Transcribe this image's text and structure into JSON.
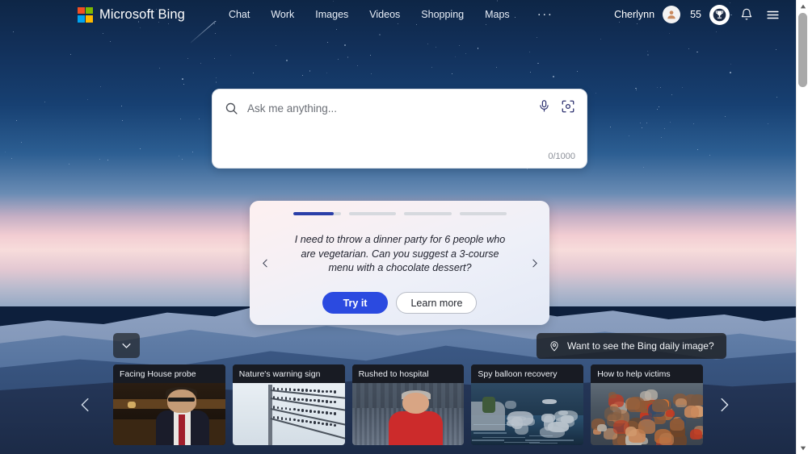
{
  "header": {
    "brand": "Microsoft Bing",
    "logo_icon": "microsoft-squares-icon",
    "logo_colors": [
      "#f25022",
      "#7fba00",
      "#00a4ef",
      "#ffb900"
    ],
    "nav": [
      {
        "label": "Chat"
      },
      {
        "label": "Work"
      },
      {
        "label": "Images"
      },
      {
        "label": "Videos"
      },
      {
        "label": "Shopping"
      },
      {
        "label": "Maps"
      }
    ],
    "more_label": "···",
    "user_name": "Cherlynn",
    "avatar_icon": "person-avatar-icon",
    "rewards_points": "55",
    "rewards_icon": "trophy-icon",
    "notifications_icon": "bell-icon",
    "menu_icon": "hamburger-menu-icon"
  },
  "search": {
    "placeholder": "Ask me anything...",
    "value": "",
    "search_icon": "search-icon",
    "mic_icon": "microphone-icon",
    "visual_search_icon": "visual-search-camera-icon",
    "char_count": "0/1000"
  },
  "suggestion_card": {
    "progress": [
      85,
      0,
      0,
      0
    ],
    "prompt": "I need to throw a dinner party for 6 people who are vegetarian. Can you suggest a 3-course menu with a chocolate dessert?",
    "try_label": "Try it",
    "learn_label": "Learn more",
    "prev_icon": "chevron-left-icon",
    "next_icon": "chevron-right-icon",
    "accent_color": "#2b4ae0"
  },
  "daily_image": {
    "label": "Want to see the Bing daily image?",
    "pin_icon": "location-pin-icon"
  },
  "expand": {
    "icon": "chevron-down-icon"
  },
  "news": {
    "prev_icon": "chevron-left-icon",
    "next_icon": "chevron-right-icon",
    "cards": [
      {
        "title": "Facing House probe"
      },
      {
        "title": "Nature's warning sign"
      },
      {
        "title": "Rushed to hospital"
      },
      {
        "title": "Spy balloon recovery"
      },
      {
        "title": "How to help victims"
      }
    ]
  },
  "scrollbar": {
    "up_icon": "scroll-up-arrow-icon",
    "down_icon": "scroll-down-arrow-icon"
  }
}
